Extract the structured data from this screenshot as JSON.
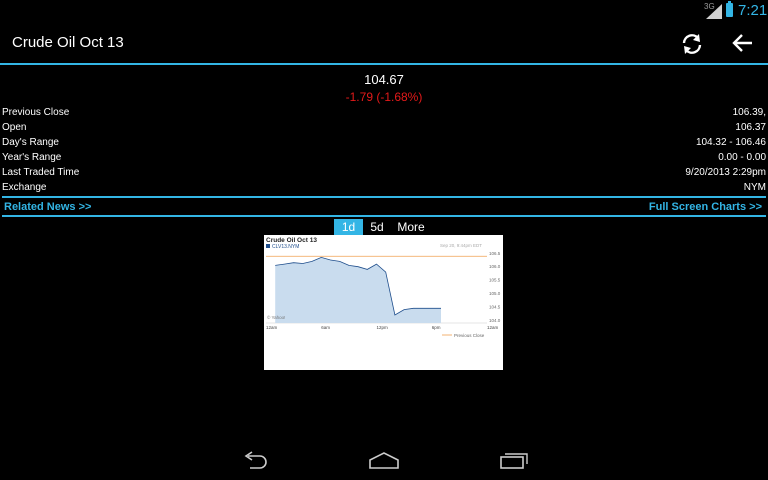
{
  "status": {
    "network": "3G",
    "time": "7:21"
  },
  "header": {
    "title": "Crude Oil Oct 13"
  },
  "quote": {
    "price": "104.67",
    "change": "-1.79 (-1.68%)"
  },
  "stats": [
    {
      "label": "Previous Close",
      "value": "106.39,"
    },
    {
      "label": "Open",
      "value": "106.37"
    },
    {
      "label": "Day's Range",
      "value": "104.32 - 106.46"
    },
    {
      "label": "Year's Range",
      "value": "0.00 - 0.00"
    },
    {
      "label": "Last Traded Time",
      "value": "9/20/2013 2:29pm"
    },
    {
      "label": "Exchange",
      "value": "NYM"
    }
  ],
  "links": {
    "news": "Related News >>",
    "charts": "Full Screen Charts >>"
  },
  "tabs": [
    {
      "label": "1d",
      "active": true
    },
    {
      "label": "5d",
      "active": false
    },
    {
      "label": "More",
      "active": false
    }
  ],
  "chart": {
    "title": "Crude Oil Oct 13",
    "symbol": "CLV13.NYM",
    "date_label": "Sep 20, 9:44pm EDT",
    "watermark": "© Yahoo!",
    "legend": "Previous Close",
    "y_ticks": [
      "106.5",
      "106.0",
      "105.5",
      "105.0",
      "104.5",
      "104.0"
    ],
    "x_ticks": [
      "12am",
      "6am",
      "12pm",
      "6pm",
      "12am"
    ],
    "colors": {
      "line": "#1f4e8c",
      "fill": "#c9dcee",
      "prev_close": "#f0a050"
    }
  },
  "chart_data": {
    "type": "area",
    "x": [
      "01:00",
      "02:00",
      "03:00",
      "04:00",
      "05:00",
      "06:00",
      "07:00",
      "08:00",
      "09:00",
      "10:00",
      "11:00",
      "12:00",
      "13:00",
      "14:00",
      "15:00",
      "16:00",
      "17:00",
      "18:00",
      "19:00"
    ],
    "series": [
      {
        "name": "CLV13.NYM",
        "values": [
          106.05,
          106.1,
          106.15,
          106.12,
          106.2,
          106.35,
          106.25,
          106.2,
          106.05,
          106.0,
          105.9,
          106.1,
          105.8,
          104.2,
          104.4,
          104.45,
          104.45,
          104.45,
          104.45
        ]
      }
    ],
    "reference": {
      "name": "Previous Close",
      "value": 106.39
    },
    "ylim": [
      103.9,
      106.55
    ],
    "x_tick_labels": [
      "12am",
      "6am",
      "12pm",
      "6pm",
      "12am"
    ],
    "title": "Crude Oil Oct 13"
  }
}
